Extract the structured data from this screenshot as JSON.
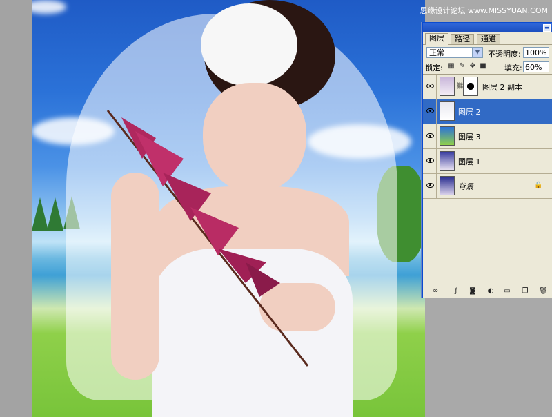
{
  "watermark": "思缘设计论坛 www.MISSYUAN.COM",
  "layers_panel": {
    "tabs": [
      "图层",
      "路径",
      "通道"
    ],
    "blend_mode": "正常",
    "opacity_label": "不透明度:",
    "opacity_value": "100%",
    "lock_label": "锁定:",
    "fill_label": "填充:",
    "fill_value": "60%",
    "layers": [
      {
        "name": "图层 2 副本",
        "selected": false,
        "has_mask": true,
        "locked": false
      },
      {
        "name": "图层 2",
        "selected": true,
        "has_mask": false,
        "locked": false
      },
      {
        "name": "图层 3",
        "selected": false,
        "has_mask": false,
        "locked": false
      },
      {
        "name": "图层 1",
        "selected": false,
        "has_mask": false,
        "locked": false
      },
      {
        "name": "背景",
        "selected": false,
        "has_mask": false,
        "locked": true
      }
    ],
    "footer_icons": [
      "link-icon",
      "layer-style-icon",
      "mask-icon",
      "adjustment-icon",
      "group-folder-icon",
      "new-layer-icon",
      "trash-icon"
    ]
  },
  "colors": {
    "selection": "#316ac5",
    "panel_bg": "#ece9d8",
    "titlebar": "#1c4fc0"
  }
}
